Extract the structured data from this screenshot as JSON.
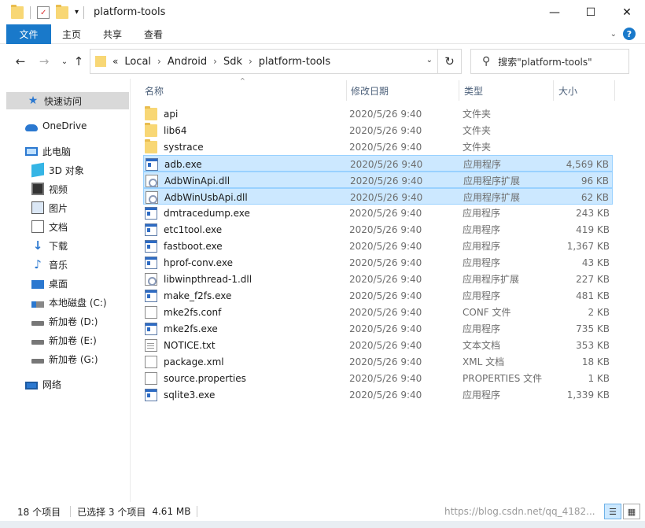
{
  "window": {
    "title": "platform-tools",
    "controls": {
      "minimize": "—",
      "maximize": "☐",
      "close": "✕"
    }
  },
  "ribbon": {
    "tabs": [
      "文件",
      "主页",
      "共享",
      "查看"
    ],
    "collapse_icon": "chevron-down-icon",
    "help": "?"
  },
  "navigation": {
    "back": "←",
    "forward": "→",
    "dropdown": "⌄",
    "up": "↑",
    "breadcrumb_prefix": "«",
    "breadcrumb": [
      "Local",
      "Android",
      "Sdk",
      "platform-tools"
    ],
    "refresh": "↻",
    "search_placeholder": "搜索\"platform-tools\"",
    "search_icon": "⚲"
  },
  "sidebar": {
    "items": [
      {
        "label": "快速访问",
        "icon": "star-icon",
        "selected": true
      },
      {
        "label": "OneDrive",
        "icon": "cloud-icon"
      },
      {
        "label": "此电脑",
        "icon": "computer-icon"
      },
      {
        "label": "3D 对象",
        "icon": "3d-objects-icon"
      },
      {
        "label": "视频",
        "icon": "video-icon"
      },
      {
        "label": "图片",
        "icon": "pictures-icon"
      },
      {
        "label": "文档",
        "icon": "documents-icon"
      },
      {
        "label": "下载",
        "icon": "download-icon"
      },
      {
        "label": "音乐",
        "icon": "music-icon"
      },
      {
        "label": "桌面",
        "icon": "desktop-icon"
      },
      {
        "label": "本地磁盘 (C:)",
        "icon": "system-disk-icon"
      },
      {
        "label": "新加卷 (D:)",
        "icon": "disk-icon"
      },
      {
        "label": "新加卷 (E:)",
        "icon": "disk-icon"
      },
      {
        "label": "新加卷 (G:)",
        "icon": "disk-icon"
      },
      {
        "label": "网络",
        "icon": "network-icon"
      }
    ]
  },
  "columns": {
    "name": "名称",
    "modified": "修改日期",
    "type": "类型",
    "size": "大小",
    "sort_indicator": "^"
  },
  "files": [
    {
      "name": "api",
      "date": "2020/5/26 9:40",
      "type": "文件夹",
      "size": "",
      "icon": "folder"
    },
    {
      "name": "lib64",
      "date": "2020/5/26 9:40",
      "type": "文件夹",
      "size": "",
      "icon": "folder"
    },
    {
      "name": "systrace",
      "date": "2020/5/26 9:40",
      "type": "文件夹",
      "size": "",
      "icon": "folder"
    },
    {
      "name": "adb.exe",
      "date": "2020/5/26 9:40",
      "type": "应用程序",
      "size": "4,569 KB",
      "icon": "exe",
      "selected": true
    },
    {
      "name": "AdbWinApi.dll",
      "date": "2020/5/26 9:40",
      "type": "应用程序扩展",
      "size": "96 KB",
      "icon": "dll",
      "selected": true
    },
    {
      "name": "AdbWinUsbApi.dll",
      "date": "2020/5/26 9:40",
      "type": "应用程序扩展",
      "size": "62 KB",
      "icon": "dll",
      "selected": true
    },
    {
      "name": "dmtracedump.exe",
      "date": "2020/5/26 9:40",
      "type": "应用程序",
      "size": "243 KB",
      "icon": "exe"
    },
    {
      "name": "etc1tool.exe",
      "date": "2020/5/26 9:40",
      "type": "应用程序",
      "size": "419 KB",
      "icon": "exe"
    },
    {
      "name": "fastboot.exe",
      "date": "2020/5/26 9:40",
      "type": "应用程序",
      "size": "1,367 KB",
      "icon": "exe"
    },
    {
      "name": "hprof-conv.exe",
      "date": "2020/5/26 9:40",
      "type": "应用程序",
      "size": "43 KB",
      "icon": "exe"
    },
    {
      "name": "libwinpthread-1.dll",
      "date": "2020/5/26 9:40",
      "type": "应用程序扩展",
      "size": "227 KB",
      "icon": "dll"
    },
    {
      "name": "make_f2fs.exe",
      "date": "2020/5/26 9:40",
      "type": "应用程序",
      "size": "481 KB",
      "icon": "exe"
    },
    {
      "name": "mke2fs.conf",
      "date": "2020/5/26 9:40",
      "type": "CONF 文件",
      "size": "2 KB",
      "icon": "blank"
    },
    {
      "name": "mke2fs.exe",
      "date": "2020/5/26 9:40",
      "type": "应用程序",
      "size": "735 KB",
      "icon": "exe"
    },
    {
      "name": "NOTICE.txt",
      "date": "2020/5/26 9:40",
      "type": "文本文档",
      "size": "353 KB",
      "icon": "doc"
    },
    {
      "name": "package.xml",
      "date": "2020/5/26 9:40",
      "type": "XML 文档",
      "size": "18 KB",
      "icon": "blank"
    },
    {
      "name": "source.properties",
      "date": "2020/5/26 9:40",
      "type": "PROPERTIES 文件",
      "size": "1 KB",
      "icon": "blank"
    },
    {
      "name": "sqlite3.exe",
      "date": "2020/5/26 9:40",
      "type": "应用程序",
      "size": "1,339 KB",
      "icon": "exe"
    }
  ],
  "status": {
    "item_count": "18 个项目",
    "selected": "已选择 3 个项目",
    "selected_size": "4.61 MB",
    "watermark": "https://blog.csdn.net/qq_4182..."
  },
  "colors": {
    "accent": "#1979ca",
    "selection": "#cce8ff",
    "selection_border": "#99d1ff"
  }
}
